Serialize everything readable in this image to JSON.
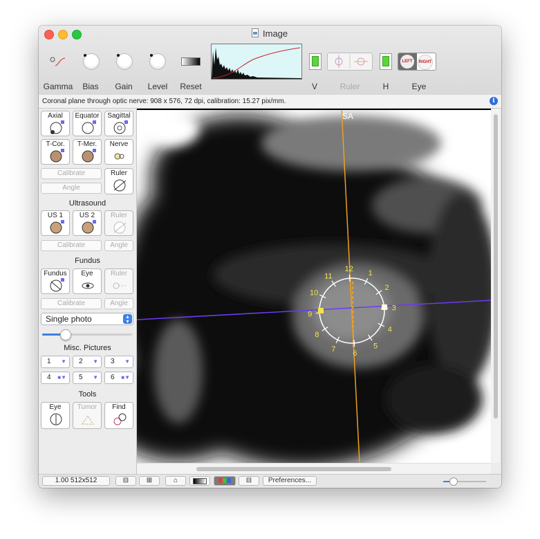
{
  "window": {
    "title": "Image"
  },
  "toolbar": {
    "gamma": "Gamma",
    "bias": "Bias",
    "gain": "Gain",
    "level": "Level",
    "reset": "Reset",
    "v": "V",
    "ruler": "Ruler",
    "h": "H",
    "eye": "Eye",
    "eye_left": "LEFT",
    "eye_right": "RIGHT"
  },
  "caption": {
    "text": "Coronal plane through optic nerve: 908 x 576, 72 dpi, calibration: 15.27 pix/mm."
  },
  "panel": {
    "row1": [
      "Axial",
      "Equator",
      "Sagittal"
    ],
    "row2": [
      "T-Cor.",
      "T-Mer.",
      "Nerve"
    ],
    "calibrate": "Calibrate",
    "angle": "Angle",
    "ruler": "Ruler",
    "ultrasound": {
      "title": "Ultrasound",
      "us1": "US 1",
      "us2": "US 2",
      "ruler": "Ruler",
      "calibrate": "Calibrate",
      "angle": "Angle"
    },
    "fundus": {
      "title": "Fundus",
      "fundus": "Fundus",
      "eye": "Eye",
      "ruler": "Ruler",
      "calibrate": "Calibrate",
      "angle": "Angle"
    },
    "select": {
      "value": "Single photo"
    },
    "slider": {
      "value": 0.25
    },
    "misc": {
      "title": "Misc. Pictures",
      "items": [
        "1",
        "2",
        "3",
        "4",
        "5",
        "6"
      ]
    },
    "tools": {
      "title": "Tools",
      "eye": "Eye",
      "tumor": "Tumor",
      "find": "Find"
    }
  },
  "image": {
    "corner_left": "4",
    "top_marker": "SA",
    "corner_right": "A",
    "clock": [
      "12",
      "1",
      "2",
      "3",
      "4",
      "5",
      "6",
      "7",
      "8",
      "9",
      "10",
      "11"
    ]
  },
  "statusbar": {
    "zoom": "1.00 512x512",
    "preferences": "Preferences..."
  },
  "colors": {
    "vertical_line": "#f0a020",
    "horizontal_line": "#6a3cf0",
    "clock_marks": "#f4e24a",
    "accent": "#3f7fe0"
  }
}
